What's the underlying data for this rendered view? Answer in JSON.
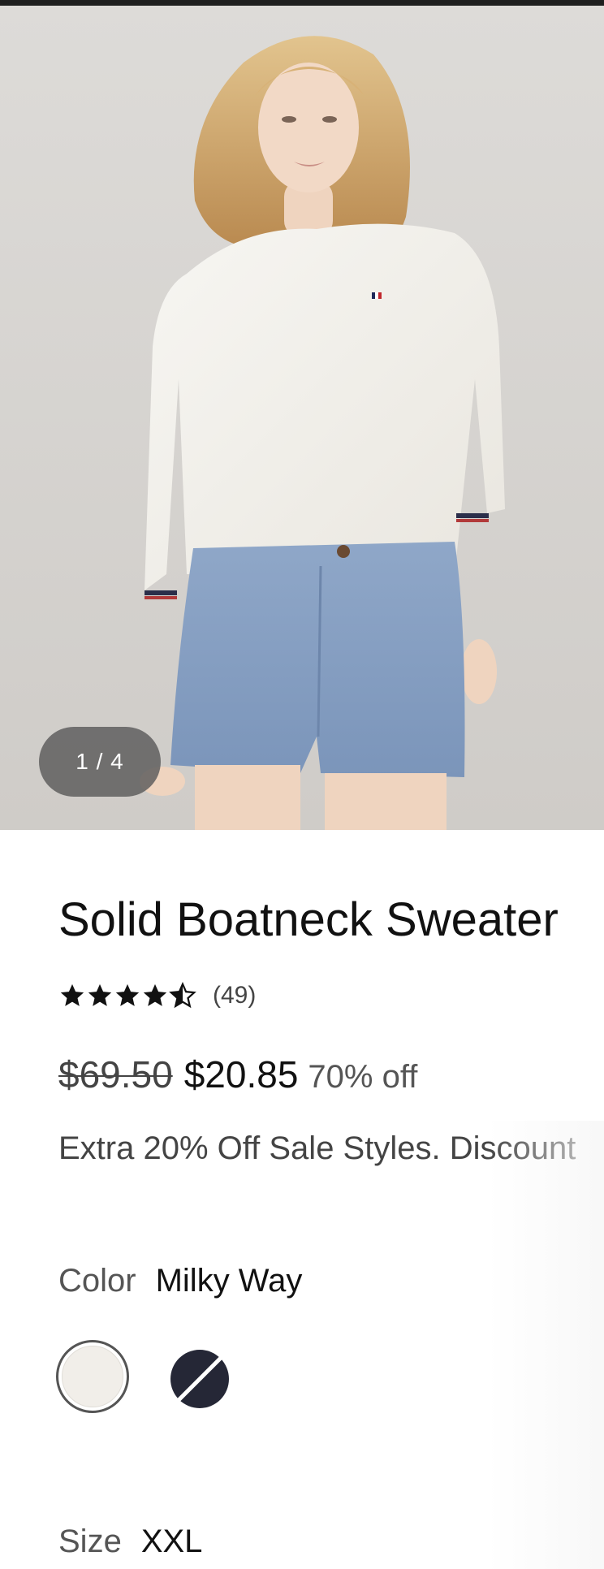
{
  "gallery": {
    "counter": "1 / 4",
    "image_alt": "Woman wearing white boatneck sweater and blue chambray shorts"
  },
  "product": {
    "title": "Solid Boatneck Sweater",
    "rating": 4.5,
    "review_count": "(49)",
    "price_original": "$69.50",
    "price_sale": "$20.85",
    "discount": "70% off",
    "promo": "Extra 20% Off Sale Styles. Discount"
  },
  "color": {
    "label": "Color",
    "selected": "Milky Way",
    "swatches": [
      {
        "name": "Milky Way",
        "hex": "#f1eee9",
        "selected": true
      },
      {
        "name": "Navy",
        "hex": "#252736",
        "selected": false,
        "unavailable": true
      }
    ]
  },
  "size": {
    "label": "Size",
    "selected": "XXL"
  },
  "colors": {
    "text": "#111111",
    "muted": "#555555",
    "star": "#111111"
  }
}
